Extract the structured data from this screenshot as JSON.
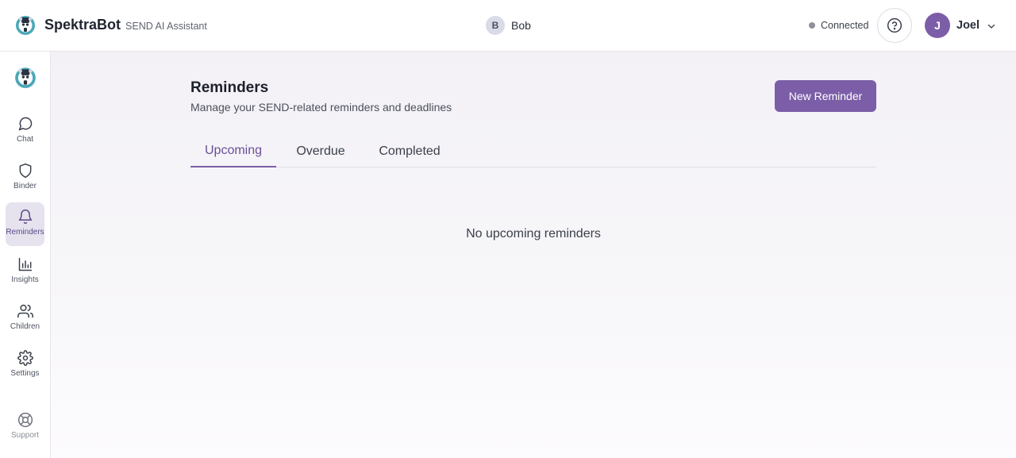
{
  "header": {
    "brand_name": "SpektraBot",
    "brand_sub": "SEND AI Assistant",
    "child_initial": "B",
    "child_name": "Bob",
    "status_text": "Connected",
    "user_initial": "J",
    "user_name": "Joel",
    "icons": [
      "logo",
      "help-icon",
      "chevron-down-icon"
    ]
  },
  "sidebar": {
    "items": [
      {
        "label": "Chat",
        "icon": "chat-icon"
      },
      {
        "label": "Binder",
        "icon": "shield-icon"
      },
      {
        "label": "Reminders",
        "icon": "bell-icon",
        "active": true
      },
      {
        "label": "Insights",
        "icon": "bar-chart-icon"
      },
      {
        "label": "Children",
        "icon": "users-icon"
      },
      {
        "label": "Settings",
        "icon": "gear-icon"
      },
      {
        "label": "Support",
        "icon": "lifebuoy-icon"
      }
    ]
  },
  "main": {
    "title": "Reminders",
    "subtitle": "Manage your SEND-related reminders and deadlines",
    "new_button": "New Reminder",
    "tabs": [
      {
        "label": "Upcoming",
        "active": true
      },
      {
        "label": "Overdue"
      },
      {
        "label": "Completed"
      }
    ],
    "empty_text": "No upcoming reminders"
  },
  "colors": {
    "accent": "#7b5ea7",
    "active_nav_bg": "#e6e2ee",
    "status_dot": "#8e919a"
  }
}
